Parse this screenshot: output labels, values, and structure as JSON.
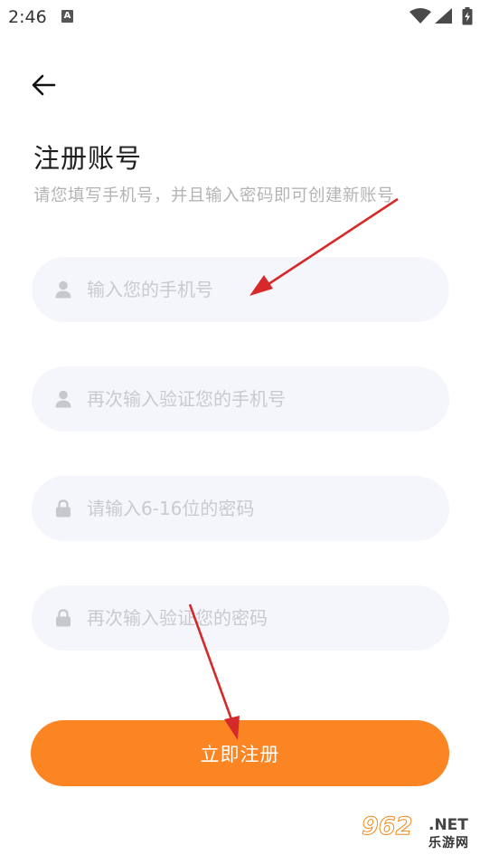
{
  "status_bar": {
    "time": "2:46",
    "notification_letter": "A"
  },
  "header": {
    "title": "注册账号",
    "subtitle": "请您填写手机号，并且输入密码即可创建新账号"
  },
  "form": {
    "fields": [
      {
        "icon": "user-icon",
        "placeholder": "输入您的手机号",
        "value": ""
      },
      {
        "icon": "user-icon",
        "placeholder": "再次输入验证您的手机号",
        "value": ""
      },
      {
        "icon": "lock-icon",
        "placeholder": "请输入6-16位的密码",
        "value": ""
      },
      {
        "icon": "lock-icon",
        "placeholder": "再次输入验证您的密码",
        "value": ""
      }
    ],
    "submit_label": "立即注册"
  },
  "watermark": {
    "number": "962",
    "suffix": ".NET",
    "cn": "乐游网"
  },
  "colors": {
    "accent": "#fb8423",
    "field_bg": "#f5f6fb",
    "placeholder": "#c9cacf",
    "annotation": "#d62a2a"
  }
}
